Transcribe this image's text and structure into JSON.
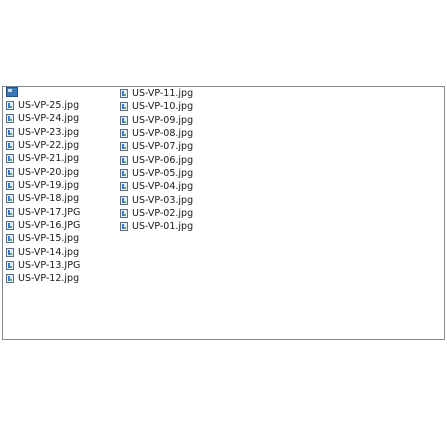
{
  "icons": {
    "file": "image-file-icon",
    "up": "folder-up-icon"
  },
  "files_col1": [
    "US-VP-25.jpg",
    "US-VP-24.jpg",
    "US-VP-23.jpg",
    "US-VP-22.jpg",
    "US-VP-21.jpg",
    "US-VP-20.jpg",
    "US-VP-19.jpg",
    "US-VP-18.jpg",
    "US-VP-17.JPG",
    "US-VP-16.JPG",
    "US-VP-15.jpg",
    "US-VP-14.jpg",
    "US-VP-13.JPG",
    "US-VP-12.jpg"
  ],
  "files_col2": [
    "US-VP-11.jpg",
    "US-VP-10.jpg",
    "US-VP-09.jpg",
    "US-VP-08.jpg",
    "US-VP-07.jpg",
    "US-VP-06.jpg",
    "US-VP-05.jpg",
    "US-VP-04.jpg",
    "US-VP-03.jpg",
    "US-VP-02.jpg",
    "US-VP-01.jpg"
  ]
}
